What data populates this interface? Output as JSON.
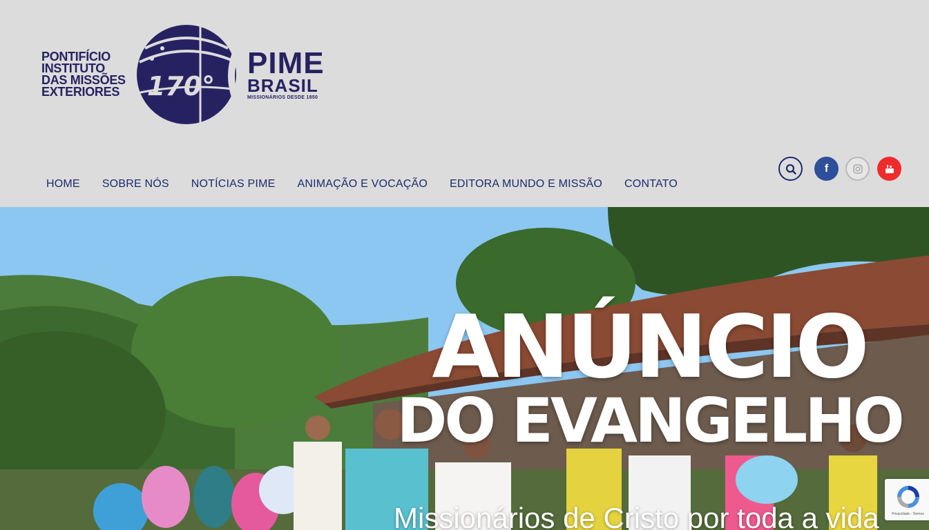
{
  "logo": {
    "left_text": [
      "PONTIFÍCIO",
      "INSTITUTO",
      "DAS MISSÕES",
      "EXTERIORES"
    ],
    "anniversary": "170°",
    "brand": "PIME",
    "country": "BRASIL",
    "tagline": "MISSIONÁRIOS DESDE 1850"
  },
  "nav": {
    "items": [
      {
        "label": "HOME"
      },
      {
        "label": "SOBRE NÓS"
      },
      {
        "label": "NOTÍCIAS PIME"
      },
      {
        "label": "ANIMAÇÃO E VOCAÇÃO"
      },
      {
        "label": "EDITORA MUNDO E MISSÃO"
      },
      {
        "label": "CONTATO"
      }
    ]
  },
  "social": {
    "search_icon": "search-icon",
    "facebook_icon": "facebook-icon",
    "instagram_icon": "instagram-icon",
    "youtube_icon": "youtube-icon",
    "facebook_glyph": "f"
  },
  "hero": {
    "title_line1": "ANÚNCIO",
    "title_line2": "DO EVANGELHO",
    "subtitle": "Missionários de Cristo por toda a vida"
  },
  "recaptcha": {
    "text": "Privacidade - Termos"
  },
  "colors": {
    "brand_navy": "#262262",
    "nav_text": "#1d2a6b",
    "header_bg": "#dcdcdc",
    "facebook": "#2e4f9a",
    "youtube": "#ef2b2b"
  }
}
